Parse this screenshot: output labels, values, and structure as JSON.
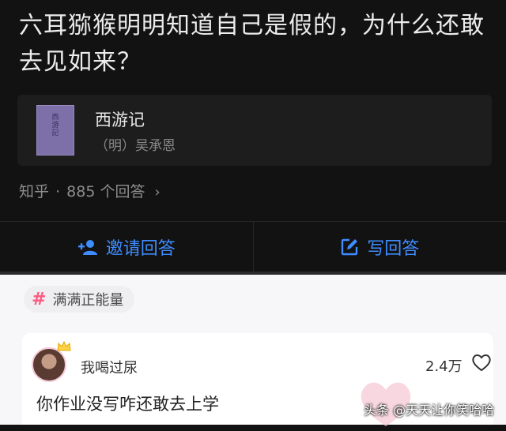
{
  "question": {
    "title": "六耳猕猴明明知道自己是假的，为什么还敢去见如来？"
  },
  "book": {
    "title": "西游记",
    "author": "（明）吴承恩",
    "cover_text": "西游記"
  },
  "meta": {
    "source": "知乎",
    "separator": "·",
    "answers": "885 个回答"
  },
  "actions": {
    "invite_label": "邀请回答",
    "write_label": "写回答",
    "color": "#3e8cff"
  },
  "tag": {
    "label": "满满正能量",
    "color": "#ff5b80"
  },
  "comment": {
    "username": "我喝过尿",
    "likes": "2.4万",
    "text": "你作业没写咋还敢去上学"
  },
  "watermark": {
    "text": "头条 @天天让你笑哈哈"
  }
}
